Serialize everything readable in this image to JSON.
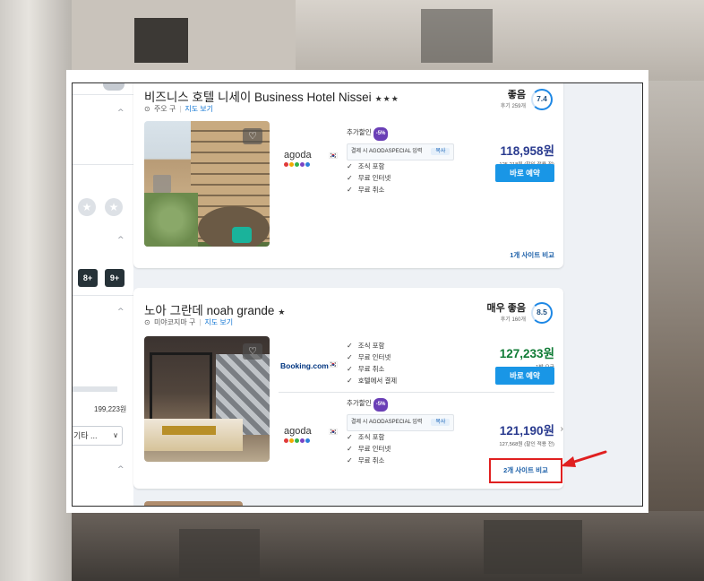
{
  "sidebar": {
    "star_glyph": "★",
    "score_chips": [
      "8+",
      "9+"
    ],
    "price_value": "199,223원",
    "select_value": "기타 ...",
    "chevron_glyph": "^",
    "select_chevron": "∨"
  },
  "hotels": [
    {
      "name": "비즈니스 호텔 니세이 Business Hotel Nissei",
      "stars": "★★★",
      "location": "주오 구",
      "map_link": "지도 보기",
      "rating_word": "좋음",
      "reviews": "후기 259개",
      "score": "7.4",
      "offers": [
        {
          "provider": "agoda",
          "promo_label": "추가할인",
          "promo_badge": "-5%",
          "coupon_text": "결제 시 AGODASPECIAL 입력",
          "coupon_copy": "복사",
          "perks": [
            "조식 포함",
            "무료 인터넷",
            "무료 취소"
          ],
          "price": "118,958원",
          "price_note": "125,218원 (할인 적용 전)",
          "book_label": "바로 예약"
        }
      ],
      "compare": "1개 사이트 비교"
    },
    {
      "name": "노아 그란데 noah grande",
      "stars": "★",
      "location": "미야코지마 구",
      "map_link": "지도 보기",
      "rating_word": "매우 좋음",
      "reviews": "후기 160개",
      "score": "8.5",
      "offers": [
        {
          "provider": "Booking.com",
          "perks": [
            "조식 포함",
            "무료 인터넷",
            "무료 취소",
            "호텔에서 결제"
          ],
          "price": "127,233원",
          "price_note": "1박 요금",
          "book_label": "바로 예약"
        },
        {
          "provider": "agoda",
          "promo_label": "추가할인",
          "promo_badge": "-5%",
          "coupon_text": "결제 시 AGODASPECIAL 입력",
          "coupon_copy": "복사",
          "perks": [
            "조식 포함",
            "무료 인터넷",
            "무료 취소"
          ],
          "price": "121,190원",
          "price_note": "127,568원 (할인 적용 전)"
        }
      ],
      "compare": "2개 사이트 비교"
    }
  ],
  "icons": {
    "check": "✓",
    "heart": "♡",
    "pin": "⊙",
    "flag": "🇰🇷",
    "chevron_right": "›"
  },
  "colors": {
    "accent_blue": "#1996e6",
    "price_blue": "#2a3b8f",
    "price_green": "#0f7b35",
    "highlight_red": "#e02020",
    "agoda_purple": "#6a3fb6"
  }
}
